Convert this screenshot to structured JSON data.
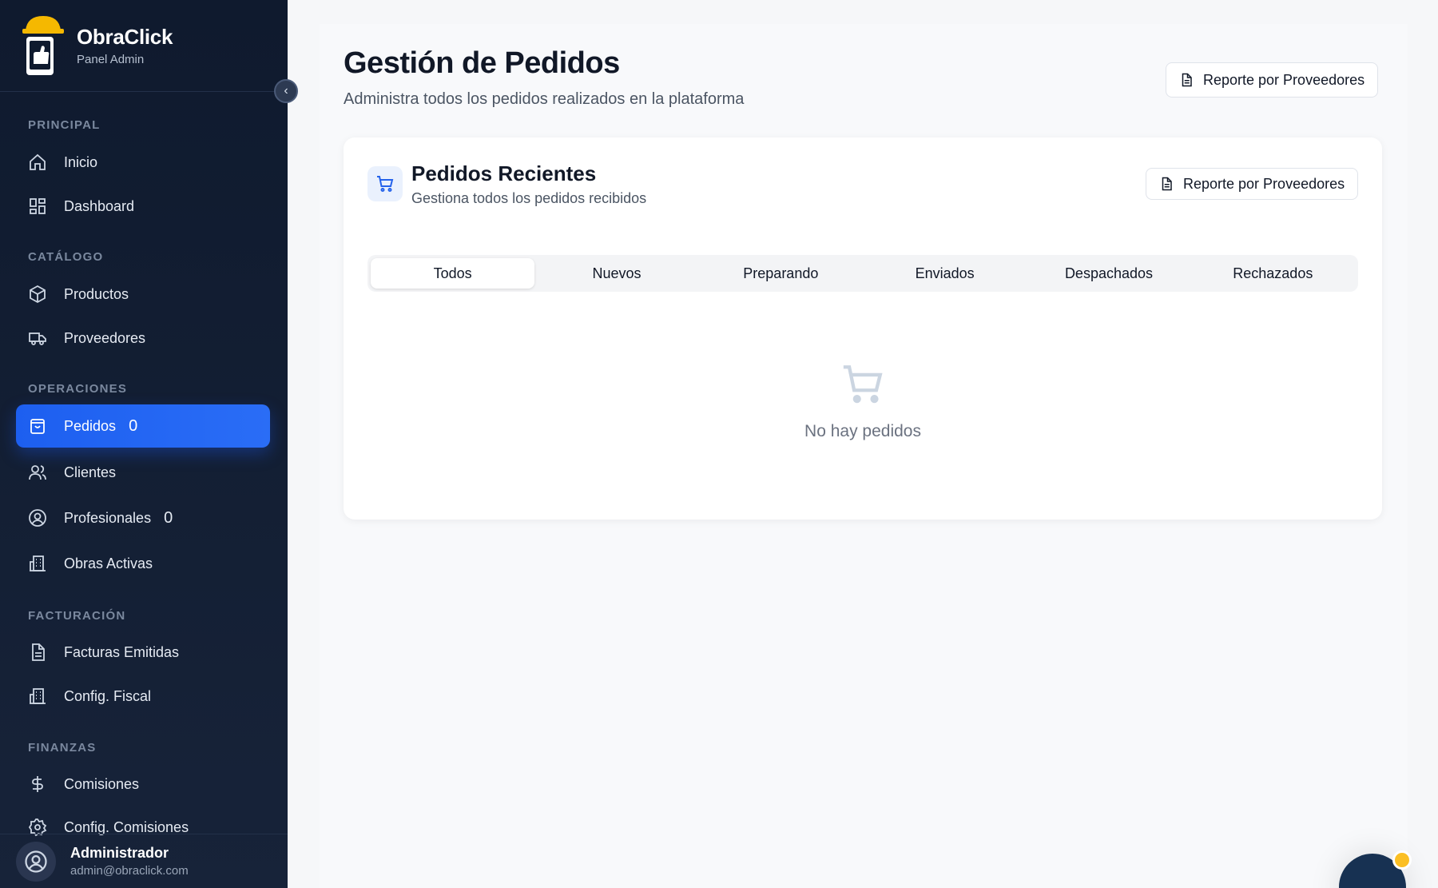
{
  "brand": {
    "name": "ObraClick",
    "subtitle": "Panel Admin"
  },
  "sidebar": {
    "sections": [
      {
        "title": "PRINCIPAL"
      },
      {
        "title": "CATÁLOGO"
      },
      {
        "title": "OPERACIONES"
      },
      {
        "title": "FACTURACIÓN"
      },
      {
        "title": "FINANZAS"
      }
    ],
    "items": [
      {
        "label": "Inicio",
        "icon": "home-icon"
      },
      {
        "label": "Dashboard",
        "icon": "grid-icon"
      },
      {
        "label": "Productos",
        "icon": "box-icon"
      },
      {
        "label": "Proveedores",
        "icon": "truck-icon"
      },
      {
        "label": "Pedidos",
        "icon": "shopping-bag-icon",
        "badge": "0",
        "active": true
      },
      {
        "label": "Clientes",
        "icon": "users-icon"
      },
      {
        "label": "Profesionales",
        "icon": "user-circle-icon",
        "badge": "0"
      },
      {
        "label": "Obras Activas",
        "icon": "building-icon"
      },
      {
        "label": "Facturas Emitidas",
        "icon": "file-text-icon"
      },
      {
        "label": "Config. Fiscal",
        "icon": "building-icon"
      },
      {
        "label": "Comisiones",
        "icon": "dollar-icon"
      },
      {
        "label": "Config. Comisiones",
        "icon": "gear-icon"
      }
    ],
    "user": {
      "name": "Administrador",
      "email": "admin@obraclick.com"
    }
  },
  "header": {
    "title": "Gestión de Pedidos",
    "subtitle": "Administra todos los pedidos realizados en la plataforma",
    "report_button": "Reporte por Proveedores"
  },
  "card": {
    "title": "Pedidos Recientes",
    "subtitle": "Gestiona todos los pedidos recibidos",
    "report_button": "Reporte por Proveedores",
    "tabs": [
      "Todos",
      "Nuevos",
      "Preparando",
      "Enviados",
      "Despachados",
      "Rechazados"
    ],
    "active_tab": "Todos",
    "empty_text": "No hay pedidos"
  },
  "colors": {
    "sidebar_bg": "#0f1a2e",
    "accent": "#1d5ff0",
    "helmet": "#f5b800",
    "notification_dot": "#fbbf24"
  }
}
